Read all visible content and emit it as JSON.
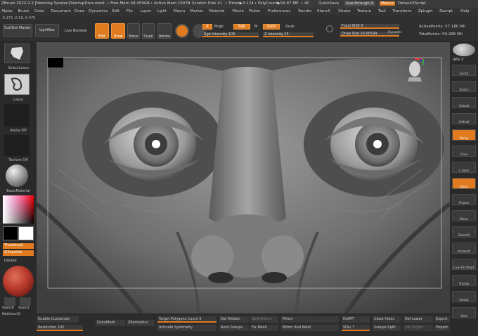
{
  "titlebar": {
    "app": "ZBrush 2022.0.2 [Henning Sanden]",
    "doc": "StartupDocument",
    "free_mem": "• Free Mem 49.459GB",
    "active_mem": "• Active Mem 16076",
    "scratch": "• Scratch Disk 41",
    "timer": "• Timer▶3.124",
    "polycount": "• PolyCount▶59.87 MP",
    "ac": "• AC",
    "quicksave": "QuickSave",
    "seethrough": "See-through  0",
    "menus": "Menus",
    "script": "DefaultZScript"
  },
  "menu": [
    "Alpha",
    "Brush",
    "Color",
    "Document",
    "Draw",
    "Dynamics",
    "Edit",
    "File",
    "Layer",
    "Light",
    "Macro",
    "Marker",
    "Material",
    "Movie",
    "Picker",
    "Preferences",
    "Render",
    "Stencil",
    "Stroke",
    "Texture",
    "Tool",
    "Transform",
    "Zplugin",
    "Zscript",
    "Help"
  ],
  "toolbar": {
    "coords": "-0.172,-0.19,-0.475",
    "subtool_master": "SubTool Master",
    "lightbox": "LightBox",
    "live_boolean": "Live Boolean",
    "edit": "Edit",
    "draw": "Draw",
    "move": "Move",
    "scale": "Scale",
    "rotate": "Rotate",
    "a": "A",
    "mrgb": "Mrgb",
    "rgb": "Rgb",
    "m": "M",
    "zadd": "Zadd",
    "zsub": "Zsub",
    "rgb_intensity": "Rgb Intensity 100",
    "z_intensity": "Z Intensity 25",
    "focal_shift": "Focal Shift 0",
    "draw_size": "Draw Size 20.00594",
    "dynamic": "Dynamic",
    "active_points": "ActivePoints: 57.180 Mil",
    "total_points": "TotalPoints: 59.268 Mil"
  },
  "left": {
    "selectlasso": "SelectLasso",
    "lasso": "Lasso",
    "alpha_off": "Alpha Off",
    "texture_off": "Texture Off",
    "basic_material": "BasicMaterial",
    "thumbnail": "Thumbnail",
    "silhouette": "Silhouette",
    "double": "Double",
    "selectr": "SelectR",
    "selectl": "SelectL",
    "maxvalue": "MidValue50"
  },
  "right": {
    "spix": "SPix 3",
    "tools": [
      "Scroll",
      "Zoom",
      "Actual",
      "AAHalf",
      "Persp",
      "Floor",
      "L.Sym",
      "Qxyz",
      "Frame",
      "Move",
      "ZoomD",
      "RotateD",
      "Line Fill PolyF",
      "Transp",
      "Ghost",
      "Solo"
    ]
  },
  "bottom": {
    "enable_customize": "Enable Customize",
    "resolution": "Resolution 192",
    "dynamesh": "DynaMesh",
    "zremesher": "ZRemesher",
    "target_polygons": "Target Polygons Count 5",
    "activate_symmetry": "Activate Symmetry",
    "del_hidden": "Del Hidden",
    "close_holes": "Close Holes",
    "auto_groups": "Auto Groups",
    "fix_mesh": "Fix Mesh",
    "split_unmasked": "SplitHidden",
    "mirror": "Mirror",
    "mirror_and_weld": "Mirror And Weld",
    "delmt": "DelMT",
    "sdiv": "SDiv 7",
    "groups_split": "Groups Split",
    "del_lower": "Del Lower",
    "del_higher": "Del Higher",
    "export": "Export",
    "project": "Project"
  },
  "colors": {
    "accent": "#e07b20",
    "material": "#b8392c"
  }
}
